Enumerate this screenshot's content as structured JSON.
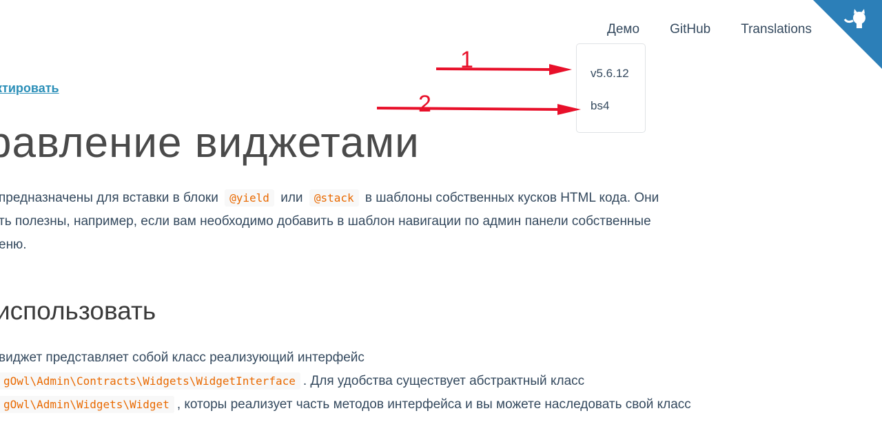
{
  "nav": {
    "demo": "Демо",
    "github": "GitHub",
    "translations": "Translations"
  },
  "versions": {
    "items": [
      "v5.6.12",
      "bs4"
    ]
  },
  "annotations": {
    "arrow1_label": "1",
    "arrow2_label": "2",
    "color": "#e8102a"
  },
  "content": {
    "edit_link": "ктировать",
    "title": "равление виджетами",
    "p1_a": "предназначены для вставки в блоки",
    "p1_code1": "@yield",
    "p1_b": "или",
    "p1_code2": "@stack",
    "p1_c": "в шаблоны собственных кусков HTML кода. Они",
    "p2": "ть полезны, например, если вам необходимо добавить в шаблон навигации по админ панели собственные",
    "p3": "еню.",
    "h2": "использовать",
    "p4": "виджет представляет собой класс реализующий интерфейс",
    "p5_code": "gOwl\\Admin\\Contracts\\Widgets\\WidgetInterface",
    "p5_text": ". Для удобства существует абстрактный класс",
    "p6_code": "gOwl\\Admin\\Widgets\\Widget",
    "p6_text": ", которы реализует часть методов интерфейса и вы можете наследовать свой класс"
  },
  "colors": {
    "corner": "#2c7fb8",
    "link": "#2b8fb8",
    "code": "#e96900"
  }
}
